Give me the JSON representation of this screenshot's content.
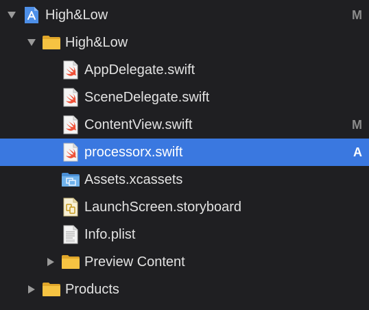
{
  "navigator": {
    "items": [
      {
        "label": "High&Low",
        "icon": "project-icon",
        "disclosure": "expanded",
        "status": "M"
      },
      {
        "label": "High&Low",
        "icon": "folder-icon",
        "disclosure": "expanded",
        "status": ""
      },
      {
        "label": "AppDelegate.swift",
        "icon": "swift-file-icon",
        "disclosure": "",
        "status": ""
      },
      {
        "label": "SceneDelegate.swift",
        "icon": "swift-file-icon",
        "disclosure": "",
        "status": ""
      },
      {
        "label": "ContentView.swift",
        "icon": "swift-file-icon",
        "disclosure": "",
        "status": "M"
      },
      {
        "label": "processorx.swift",
        "icon": "swift-file-icon",
        "disclosure": "",
        "status": "A",
        "selected": true
      },
      {
        "label": "Assets.xcassets",
        "icon": "asset-catalog-icon",
        "disclosure": "",
        "status": ""
      },
      {
        "label": "LaunchScreen.storyboard",
        "icon": "storyboard-file-icon",
        "disclosure": "",
        "status": ""
      },
      {
        "label": "Info.plist",
        "icon": "plist-file-icon",
        "disclosure": "",
        "status": ""
      },
      {
        "label": "Preview Content",
        "icon": "folder-icon",
        "disclosure": "collapsed",
        "status": ""
      },
      {
        "label": "Products",
        "icon": "folder-icon",
        "disclosure": "collapsed",
        "status": ""
      }
    ]
  },
  "colors": {
    "background": "#1f1f22",
    "selection": "#3a78e0",
    "folder": "#f6c342",
    "swift_orange": "#f05138",
    "status_text": "#8c8c8c"
  }
}
